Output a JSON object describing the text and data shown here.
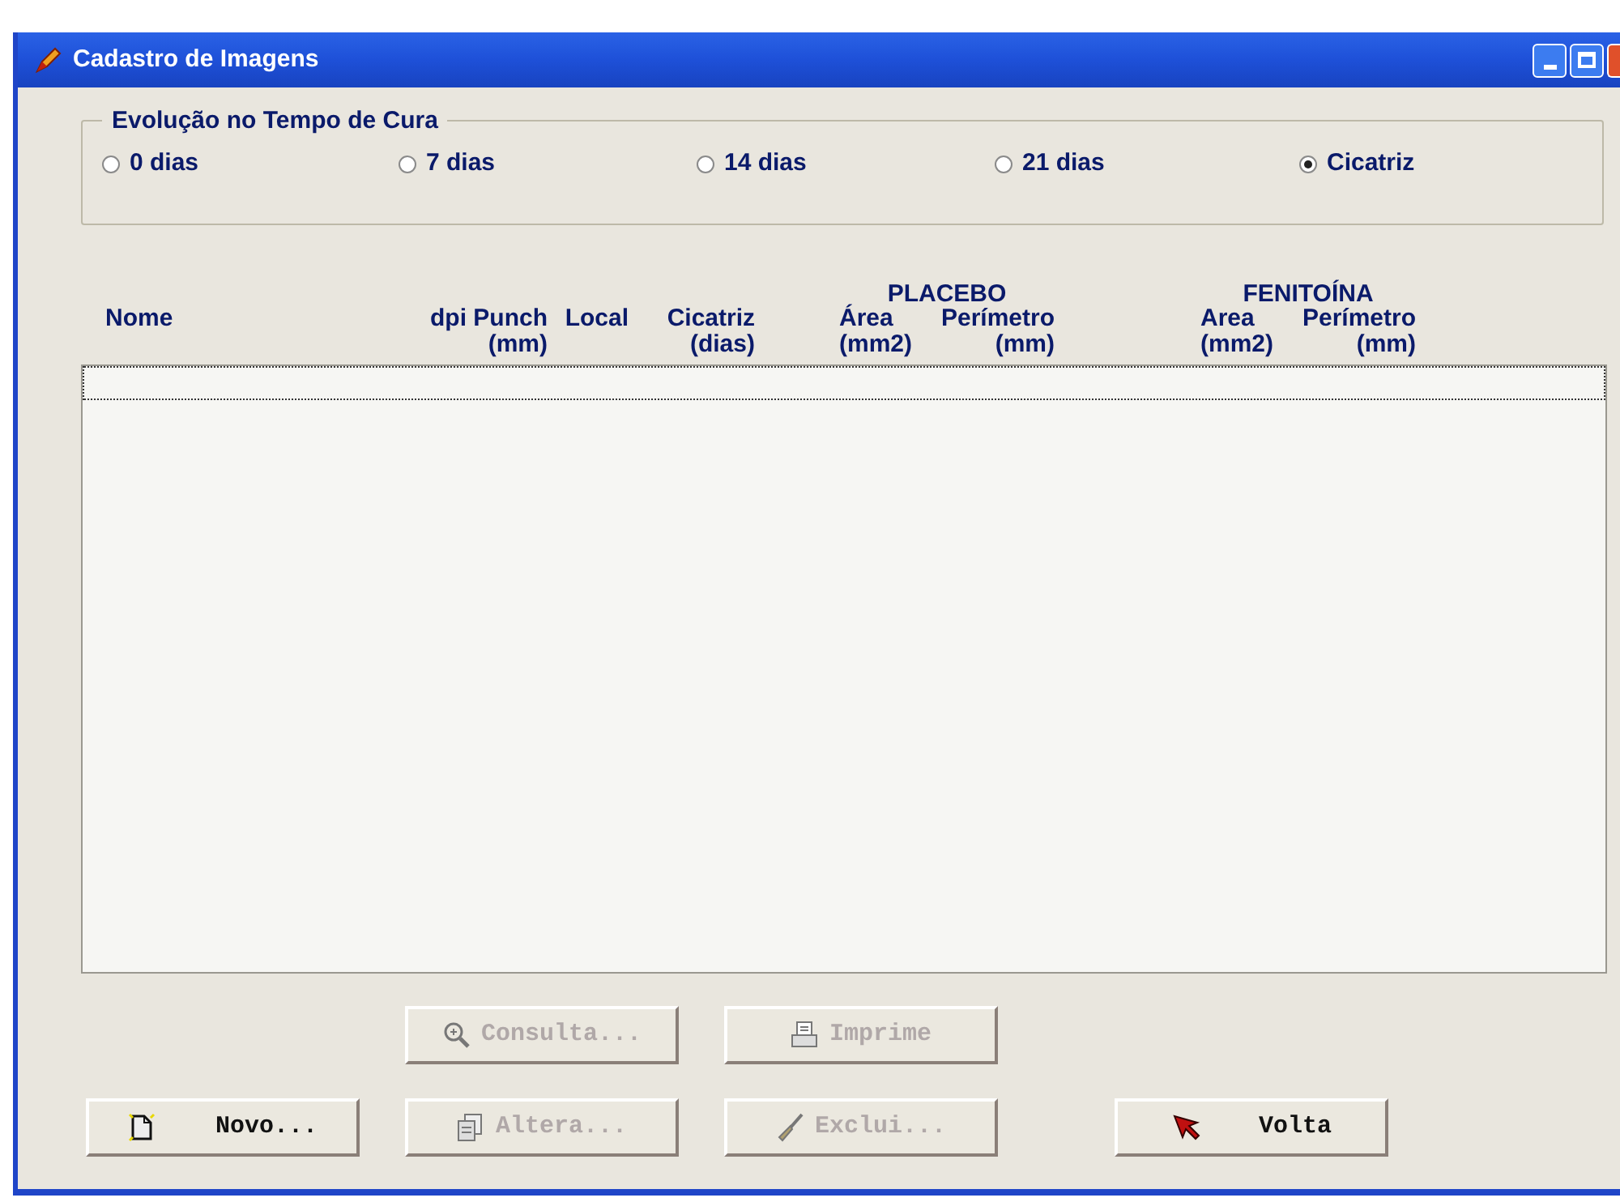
{
  "window": {
    "title": "Cadastro de Imagens"
  },
  "group": {
    "title": "Evolução no Tempo de Cura",
    "options": [
      {
        "label": "0 dias",
        "selected": false
      },
      {
        "label": "7 dias",
        "selected": false
      },
      {
        "label": "14 dias",
        "selected": false
      },
      {
        "label": "21 dias",
        "selected": false
      },
      {
        "label": "Cicatriz",
        "selected": true
      }
    ]
  },
  "table": {
    "columns": [
      {
        "label": "Nome"
      },
      {
        "label": "dpi"
      },
      {
        "label": "Punch",
        "unit": "(mm)"
      },
      {
        "label": "Local"
      },
      {
        "label": "Cicatriz",
        "unit": "(dias)"
      }
    ],
    "column_groups": [
      {
        "title": "PLACEBO",
        "columns": [
          {
            "label": "Área",
            "unit": "(mm2)"
          },
          {
            "label": "Perímetro",
            "unit": "(mm)"
          }
        ]
      },
      {
        "title": "FENITOÍNA",
        "columns": [
          {
            "label": "Area",
            "unit": "(mm2)"
          },
          {
            "label": "Perímetro",
            "unit": "(mm)"
          }
        ]
      }
    ]
  },
  "buttons": [
    {
      "label": "Consulta...",
      "kind": "search",
      "disabled": true
    },
    {
      "label": "Imprime",
      "kind": "print",
      "disabled": true
    },
    {
      "label": "Novo...",
      "kind": "new",
      "disabled": false
    },
    {
      "label": "Altera...",
      "kind": "edit",
      "disabled": true
    },
    {
      "label": "Exclui...",
      "kind": "delete",
      "disabled": true
    },
    {
      "label": "Volta",
      "kind": "back",
      "disabled": false
    }
  ]
}
